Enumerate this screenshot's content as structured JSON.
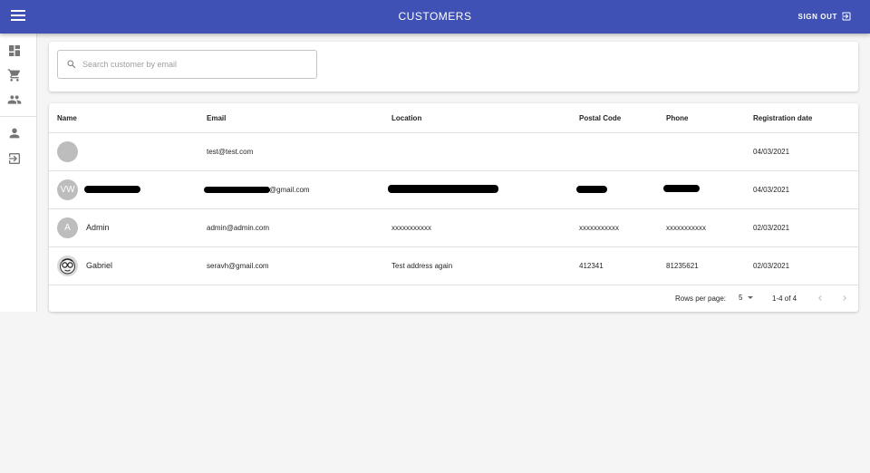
{
  "appbar": {
    "title": "CUSTOMERS",
    "signout_label": "SIGN OUT"
  },
  "drawer": {
    "items": [
      {
        "name": "dashboard-icon"
      },
      {
        "name": "shopping-cart-icon"
      },
      {
        "name": "people-icon"
      },
      {
        "name": "person-icon"
      },
      {
        "name": "exit-icon"
      }
    ]
  },
  "search": {
    "placeholder": "Search customer by email",
    "value": ""
  },
  "table": {
    "headers": [
      "Name",
      "Email",
      "Location",
      "Postal Code",
      "Phone",
      "Registration date"
    ],
    "rows": [
      {
        "avatar": "",
        "name": "",
        "email": "test@test.com",
        "location": "",
        "postal": "",
        "phone": "",
        "date": "04/03/2021"
      },
      {
        "avatar": "VW",
        "name": "",
        "email": "@gmail.com",
        "location": "",
        "postal": "",
        "phone": "",
        "date": "04/03/2021"
      },
      {
        "avatar": "A",
        "name": "Admin",
        "email": "admin@admin.com",
        "location": "xxxxxxxxxxx",
        "postal": "xxxxxxxxxxx",
        "phone": "xxxxxxxxxxx",
        "date": "02/03/2021"
      },
      {
        "avatar": "",
        "name": "Gabriel",
        "email": "seravh@gmail.com",
        "location": "Test address again",
        "postal": "412341",
        "phone": "81235621",
        "date": "02/03/2021"
      }
    ]
  },
  "pagination": {
    "rows_per_page_label": "Rows per page:",
    "rows_per_page": "5",
    "range": "1-4 of 4"
  },
  "colors": {
    "appbar": "#3f51b5",
    "background": "#f5f5f5",
    "avatar": "#bdbdbd"
  }
}
